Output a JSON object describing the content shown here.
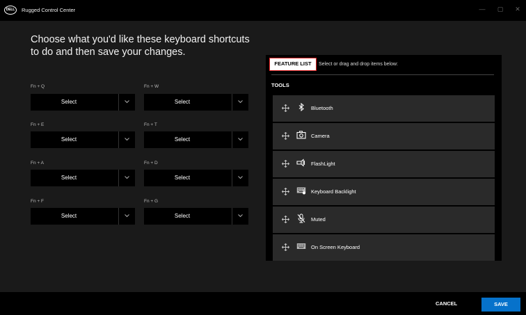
{
  "window": {
    "app_title": "Rugged Control Center",
    "logo_text": "DELL",
    "controls": {
      "minimize": "—",
      "maximize": "▢",
      "close": "✕"
    }
  },
  "heading": "Choose what you'd like these keyboard shortcuts to do and then save your changes.",
  "shortcuts": [
    {
      "label": "Fn + Q",
      "value": "Select"
    },
    {
      "label": "Fn + W",
      "value": "Select"
    },
    {
      "label": "Fn + E",
      "value": "Select"
    },
    {
      "label": "Fn + T",
      "value": "Select"
    },
    {
      "label": "Fn + A",
      "value": "Select"
    },
    {
      "label": "Fn + D",
      "value": "Select"
    },
    {
      "label": "Fn + F",
      "value": "Select"
    },
    {
      "label": "Fn + G",
      "value": "Select"
    }
  ],
  "feature_panel": {
    "button_label": "FEATURE LIST",
    "hint": "Select or drag and drop items below:",
    "section_label": "TOOLS",
    "items": [
      {
        "name": "Bluetooth",
        "icon": "bluetooth-icon"
      },
      {
        "name": "Camera",
        "icon": "camera-icon"
      },
      {
        "name": "FlashLight",
        "icon": "flashlight-icon"
      },
      {
        "name": "Keyboard Backlight",
        "icon": "keyboard-backlight-icon"
      },
      {
        "name": "Muted",
        "icon": "microphone-muted-icon"
      },
      {
        "name": "On Screen Keyboard",
        "icon": "keyboard-icon"
      }
    ]
  },
  "footer": {
    "cancel_label": "CANCEL",
    "save_label": "SAVE"
  },
  "colors": {
    "accent": "#0672cb",
    "highlight_border": "#e02020",
    "item_bg": "#2a2a2a"
  }
}
